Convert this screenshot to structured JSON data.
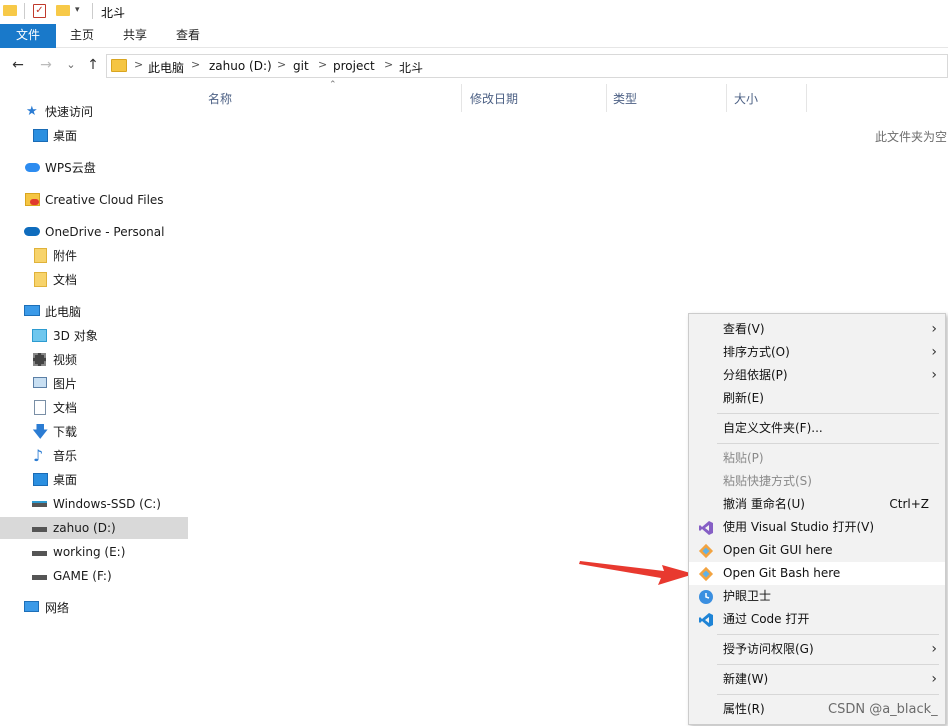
{
  "window": {
    "title": "北斗"
  },
  "ribbon": {
    "tabs": [
      "文件",
      "主页",
      "共享",
      "查看"
    ]
  },
  "address": {
    "crumbs": [
      "此电脑",
      "zahuo (D:)",
      "git",
      "project",
      "北斗"
    ],
    "separator": ">"
  },
  "nav": {
    "back": "←",
    "forward": "→",
    "recent": "⌄",
    "up": "↑"
  },
  "sidebar": {
    "items": [
      {
        "label": "快速访问",
        "icon": "star-icon",
        "indent": 0
      },
      {
        "label": "桌面",
        "icon": "desktop-icon",
        "indent": 1
      },
      {
        "label": "WPS云盘",
        "icon": "cloud-icon",
        "indent": 0
      },
      {
        "label": "Creative Cloud Files",
        "icon": "creative-cloud-icon",
        "indent": 0
      },
      {
        "label": "OneDrive - Personal",
        "icon": "onedrive-icon",
        "indent": 0
      },
      {
        "label": "附件",
        "icon": "folder-icon",
        "indent": 1
      },
      {
        "label": "文档",
        "icon": "folder-icon",
        "indent": 1
      },
      {
        "label": "此电脑",
        "icon": "pc-icon",
        "indent": 0
      },
      {
        "label": "3D 对象",
        "icon": "cube-icon",
        "indent": 1
      },
      {
        "label": "视频",
        "icon": "video-icon",
        "indent": 1
      },
      {
        "label": "图片",
        "icon": "picture-icon",
        "indent": 1
      },
      {
        "label": "文档",
        "icon": "document-icon",
        "indent": 1
      },
      {
        "label": "下载",
        "icon": "download-icon",
        "indent": 1
      },
      {
        "label": "音乐",
        "icon": "music-icon",
        "indent": 1
      },
      {
        "label": "桌面",
        "icon": "desktop-icon",
        "indent": 1
      },
      {
        "label": "Windows-SSD (C:)",
        "icon": "drive-icon",
        "indent": 1
      },
      {
        "label": "zahuo (D:)",
        "icon": "drive-icon",
        "indent": 1,
        "selected": true
      },
      {
        "label": "working (E:)",
        "icon": "drive-icon",
        "indent": 1
      },
      {
        "label": "GAME (F:)",
        "icon": "drive-icon",
        "indent": 1
      },
      {
        "label": "网络",
        "icon": "network-icon",
        "indent": 0
      }
    ]
  },
  "columns": [
    "名称",
    "修改日期",
    "类型",
    "大小"
  ],
  "empty_text": "此文件夹为空",
  "context_menu": {
    "items": [
      {
        "label": "查看(V)",
        "submenu": true
      },
      {
        "label": "排序方式(O)",
        "submenu": true
      },
      {
        "label": "分组依据(P)",
        "submenu": true
      },
      {
        "label": "刷新(E)"
      },
      {
        "label": "自定义文件夹(F)..."
      },
      {
        "label": "粘贴(P)",
        "disabled": true
      },
      {
        "label": "粘贴快捷方式(S)",
        "disabled": true
      },
      {
        "label": "撤消 重命名(U)",
        "shortcut": "Ctrl+Z"
      },
      {
        "label": "使用 Visual Studio 打开(V)",
        "icon": "visual-studio-icon"
      },
      {
        "label": "Open Git GUI here",
        "icon": "git-icon"
      },
      {
        "label": "Open Git Bash here",
        "icon": "git-icon",
        "highlighted": true
      },
      {
        "label": "护眼卫士",
        "icon": "eye-guard-icon"
      },
      {
        "label": "通过 Code 打开",
        "icon": "vscode-icon"
      },
      {
        "label": "授予访问权限(G)",
        "submenu": true
      },
      {
        "label": "新建(W)",
        "submenu": true
      },
      {
        "label": "属性(R)"
      }
    ]
  },
  "watermark": "CSDN @a_black_",
  "colors": {
    "accent": "#1979ca",
    "arrow": "#e8392f",
    "selected": "#d9d9d9"
  }
}
